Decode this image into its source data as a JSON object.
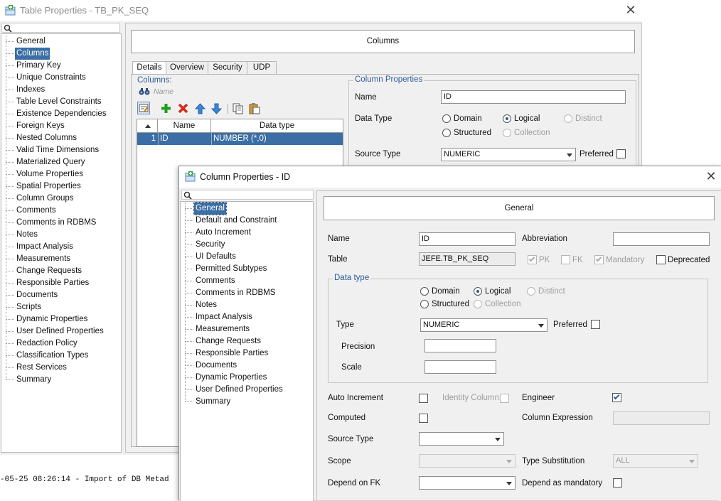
{
  "main_window": {
    "title": "Table Properties - TB_PK_SEQ",
    "nav": [
      "General",
      "Columns",
      "Primary Key",
      "Unique Constraints",
      "Indexes",
      "Table Level Constraints",
      "Existence Dependencies",
      "Foreign Keys",
      "Nested Columns",
      "Valid Time Dimensions",
      "Materialized Query",
      "Volume Properties",
      "Spatial Properties",
      "Column Groups",
      "Comments",
      "Comments in RDBMS",
      "Notes",
      "Impact Analysis",
      "Measurements",
      "Change Requests",
      "Responsible Parties",
      "Documents",
      "Scripts",
      "Dynamic Properties",
      "User Defined Properties",
      "Redaction Policy",
      "Classification Types",
      "Rest Services",
      "Summary"
    ],
    "nav_selected": "Columns",
    "page_title": "Columns",
    "tabs": [
      "Details",
      "Overview",
      "Security",
      "UDP"
    ],
    "active_tab": "Details",
    "columns_label": "Columns:",
    "filter_placeholder": "Name",
    "table": {
      "headers": [
        "Name",
        "Data type"
      ],
      "rows": [
        {
          "num": "1",
          "name": "ID",
          "type": "NUMBER (*,0)"
        }
      ]
    },
    "column_properties": {
      "legend": "Column Properties",
      "name_label": "Name",
      "name_value": "ID",
      "data_type_label": "Data Type",
      "opt_domain": "Domain",
      "opt_logical": "Logical",
      "opt_distinct": "Distinct",
      "opt_structured": "Structured",
      "opt_collection": "Collection",
      "source_type_label": "Source Type",
      "source_type_value": "NUMERIC",
      "preferred_label": "Preferred"
    }
  },
  "log_text": "-05-25 08:26:14 - Import of DB Metad",
  "dialog": {
    "title": "Column Properties - ID",
    "nav": [
      "General",
      "Default and Constraint",
      "Auto Increment",
      "Security",
      "UI Defaults",
      "Permitted Subtypes",
      "Comments",
      "Comments in RDBMS",
      "Notes",
      "Impact Analysis",
      "Measurements",
      "Change Requests",
      "Responsible Parties",
      "Documents",
      "Dynamic Properties",
      "User Defined Properties",
      "Summary"
    ],
    "nav_selected": "General",
    "page_title": "General",
    "form": {
      "name_label": "Name",
      "name_value": "ID",
      "abbreviation_label": "Abbreviation",
      "abbreviation_value": "",
      "table_label": "Table",
      "table_value": "JEFE.TB_PK_SEQ",
      "pk_label": "PK",
      "fk_label": "FK",
      "mandatory_label": "Mandatory",
      "deprecated_label": "Deprecated",
      "data_type_legend": "Data type",
      "opt_domain": "Domain",
      "opt_logical": "Logical",
      "opt_distinct": "Distinct",
      "opt_structured": "Structured",
      "opt_collection": "Collection",
      "type_label": "Type",
      "type_value": "NUMERIC",
      "preferred_label": "Preferred",
      "precision_label": "Precision",
      "precision_value": "",
      "scale_label": "Scale",
      "scale_value": "",
      "auto_increment_label": "Auto Increment",
      "identity_column_label": "Identity Column",
      "engineer_label": "Engineer",
      "computed_label": "Computed",
      "column_expression_label": "Column Expression",
      "source_type_label": "Source Type",
      "source_type_value": "",
      "scope_label": "Scope",
      "scope_value": "",
      "type_substitution_label": "Type Substitution",
      "type_substitution_value": "ALL",
      "depend_on_fk_label": "Depend on FK",
      "depend_on_fk_value": "",
      "depend_as_mandatory_label": "Depend as mandatory"
    }
  },
  "colors": {
    "selection": "#3a6ea5",
    "accent_blue": "#2a5ca8",
    "legend_blue": "#2e5d9a",
    "add_green": "#1e9e1e",
    "delete_red": "#d42a1e"
  },
  "icons": {
    "app": "table-properties-icon",
    "add": "plus-icon",
    "remove": "x-icon",
    "up": "arrow-up-icon",
    "down": "arrow-down-icon",
    "copy": "copy-icon",
    "paste": "paste-icon",
    "binoculars": "binoculars-icon"
  }
}
